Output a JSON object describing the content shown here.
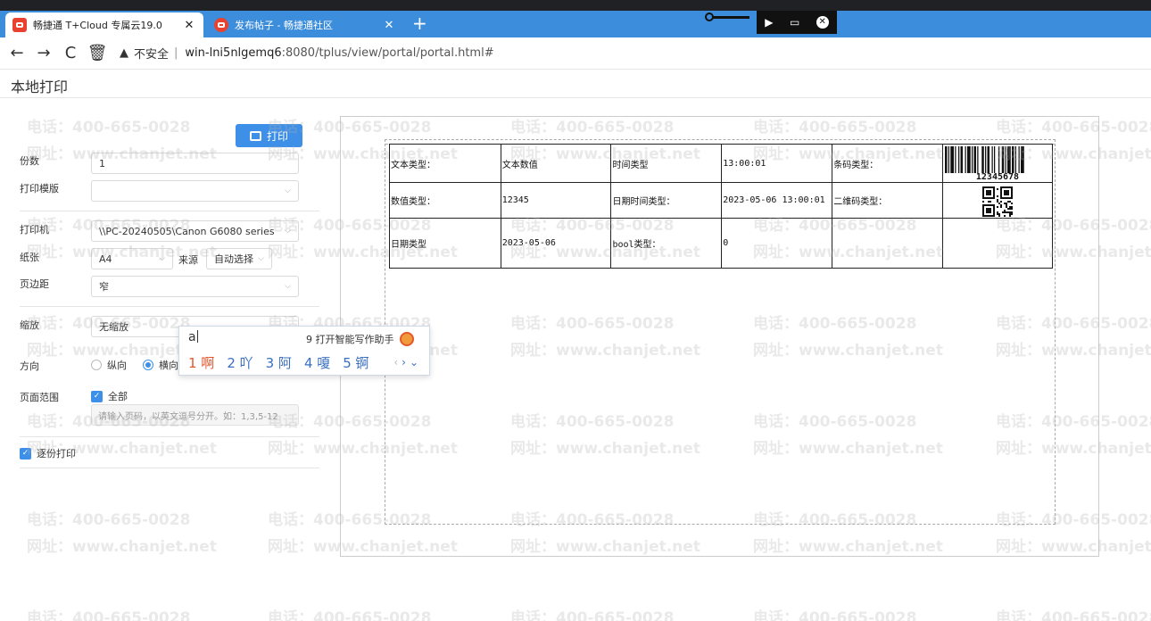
{
  "browser": {
    "tabs": [
      {
        "title": "畅捷通 T+Cloud 专属云19.0",
        "close": "✕"
      },
      {
        "title": "发布帖子 - 畅捷通社区",
        "close": "✕"
      }
    ],
    "new_tab": "+",
    "nav": {
      "back": "←",
      "forward": "→",
      "reload": "C",
      "trash": "🗑"
    },
    "url": {
      "warning": "▲",
      "insecure": "不安全",
      "separator": "|",
      "host": "win-lni5nlgemq6",
      "path": ":8080/tplus/view/portal/portal.html#"
    },
    "ime_toolbar": {
      "cursor": "▶",
      "keyboard": "▭",
      "close": "✕"
    }
  },
  "page": {
    "title": "本地打印"
  },
  "panel": {
    "print_button": "打印",
    "copies": {
      "label": "份数",
      "value": "1"
    },
    "template": {
      "label": "打印模版",
      "value": ""
    },
    "printer": {
      "label": "打印机",
      "value": "\\\\PC-20240505\\Canon G6080 series"
    },
    "paper": {
      "label": "纸张",
      "value": "A4",
      "source_label": "来源",
      "source_value": "自动选择"
    },
    "margin": {
      "label": "页边距",
      "value": "窄"
    },
    "zoom": {
      "label": "缩放",
      "value": "无缩放"
    },
    "orientation": {
      "label": "方向",
      "options": [
        "纵向",
        "横向"
      ],
      "selected": 1
    },
    "range": {
      "label": "页面范围",
      "all_label": "全部",
      "placeholder": "请输入页码，以英文逗号分开。如：1,3,5-12"
    },
    "collate": {
      "label": "逐份打印"
    },
    "caret": "⌵"
  },
  "ime_popup": {
    "input": "a",
    "assist": "9 打开智能写作助手",
    "candidates": [
      "1 啊",
      "2 吖",
      "3 阿",
      "4 嗄",
      "5 锕"
    ],
    "prev": "‹",
    "next": "›",
    "expand": "⌄"
  },
  "preview": {
    "rows": [
      [
        "文本类型：",
        "文本数值",
        "时间类型",
        "13:00:01",
        "条码类型："
      ],
      [
        "数值类型：",
        "12345",
        "日期时间类型：",
        "2023-05-06 13:00:01",
        "二维码类型："
      ],
      [
        "日期类型",
        "2023-05-06",
        "bool类型：",
        "0",
        ""
      ]
    ],
    "barcode_value": "12345678"
  },
  "watermark": {
    "phone": "电话：400-665-0028",
    "site": "网址：www.chanjet.net"
  }
}
